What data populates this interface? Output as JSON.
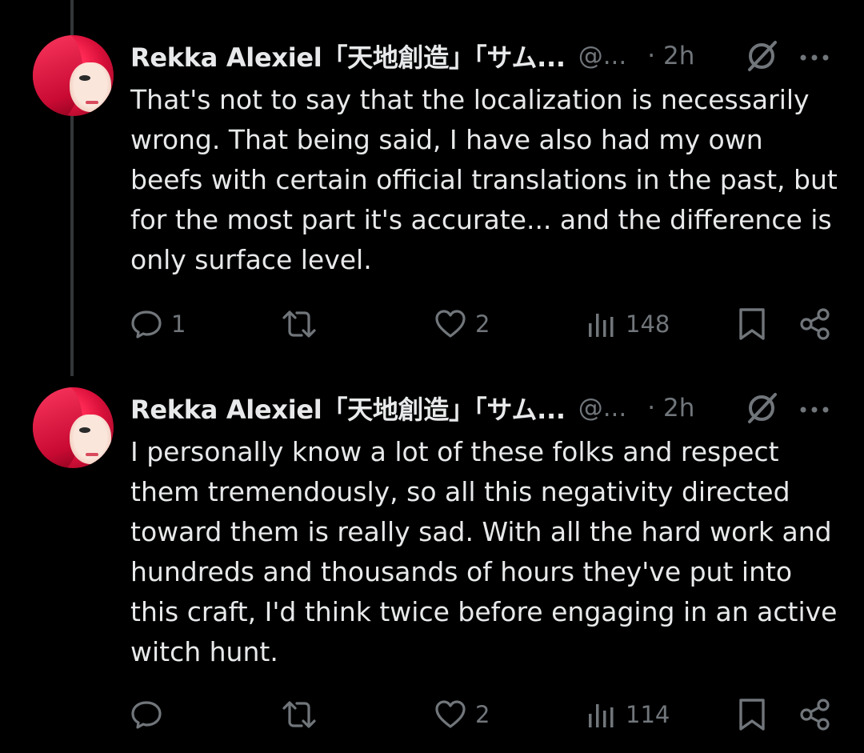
{
  "tweets": [
    {
      "author": "Rekka Alexiel「天地創造」「サム...",
      "handle": "@...",
      "time": "· 2h",
      "text": "That's not to say that the localization is necessarily wrong. That being said, I have also had my own beefs with certain official translations in the past, but for the most part it's accurate... and the difference is only surface level.",
      "replies": "1",
      "retweets": "",
      "likes": "2",
      "views": "148"
    },
    {
      "author": "Rekka Alexiel「天地創造」「サム...",
      "handle": "@...",
      "time": "· 2h",
      "text": "I personally know a lot of these folks and respect them tremendously, so all this negativity directed toward them is really sad. With all the hard work and hundreds and thousands of hours they've put into this craft, I'd think twice before engaging in an active witch hunt.",
      "replies": "",
      "retweets": "",
      "likes": "2",
      "views": "114"
    }
  ],
  "icons": {
    "reply": "reply-icon",
    "retweet": "retweet-icon",
    "like": "heart-icon",
    "views": "views-icon",
    "bookmark": "bookmark-icon",
    "share": "share-icon",
    "grok": "grok-icon",
    "more": "more-icon"
  },
  "colors": {
    "background": "#000000",
    "text": "#e7e9ea",
    "secondary": "#71767b",
    "thread_line": "#333639"
  }
}
